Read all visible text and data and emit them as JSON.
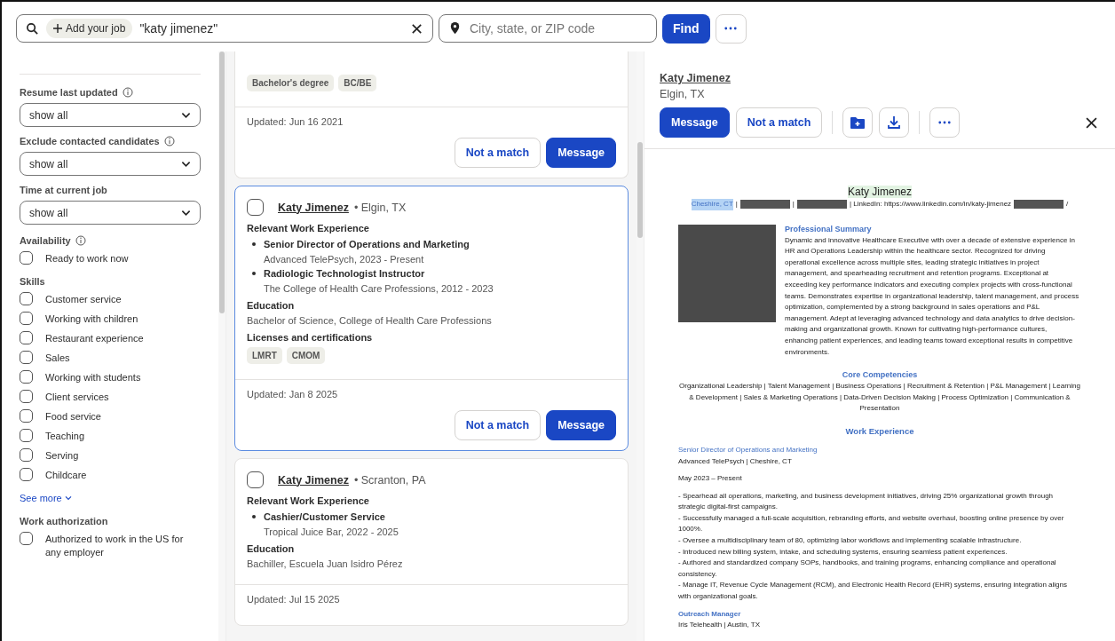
{
  "search": {
    "chip": "Add your job",
    "query": "\"katy jimenez\"",
    "location_placeholder": "City, state, or ZIP code",
    "find": "Find"
  },
  "filters": {
    "dropdowns": [
      {
        "label": "Resume last updated",
        "info": true,
        "value": "show all"
      },
      {
        "label": "Exclude contacted candidates",
        "info": true,
        "value": "show all"
      },
      {
        "label": "Time at current job",
        "info": false,
        "value": "show all"
      }
    ],
    "groups": [
      {
        "label": "Availability",
        "info": true,
        "options": [
          {
            "label": "Ready to work now",
            "checked": false
          }
        ]
      },
      {
        "label": "Skills",
        "info": false,
        "options": [
          {
            "label": "Customer service",
            "checked": false
          },
          {
            "label": "Working with children",
            "checked": false
          },
          {
            "label": "Restaurant experience",
            "checked": false
          },
          {
            "label": "Sales",
            "checked": false
          },
          {
            "label": "Working with students",
            "checked": false
          },
          {
            "label": "Client services",
            "checked": false
          },
          {
            "label": "Food service",
            "checked": false
          },
          {
            "label": "Teaching",
            "checked": false
          },
          {
            "label": "Serving",
            "checked": false
          },
          {
            "label": "Childcare",
            "checked": false
          }
        ],
        "more": "See more"
      },
      {
        "label": "Work authorization",
        "info": false,
        "options": [
          {
            "label": "Authorized to work in the US for any employer",
            "checked": false
          }
        ]
      }
    ]
  },
  "candidates": [
    {
      "selected": false,
      "sections": [
        {
          "kind": "tags",
          "items": [
            "Bachelor's degree",
            "BC/BE"
          ]
        }
      ],
      "updated": "Updated: Jun 16 2021",
      "actions": [
        "Not a match",
        "Message"
      ]
    },
    {
      "selected": true,
      "checked": false,
      "name": "Katy Jimenez",
      "location": "• Elgin, TX",
      "sections": [
        {
          "kind": "jobs",
          "heading": "Relevant Work Experience",
          "items": [
            {
              "title": "Senior Director of Operations and Marketing",
              "detail": "Advanced TelePsych, 2023 - Present"
            },
            {
              "title": "Radiologic Technologist Instructor",
              "detail": "The College of Health Care Professions, 2012 - 2023"
            }
          ]
        },
        {
          "kind": "text",
          "heading": "Education",
          "items": [
            "Bachelor of Science, College of Health Care Professions"
          ]
        },
        {
          "kind": "tags",
          "heading": "Licenses and certifications",
          "items": [
            "LMRT",
            "CMOM"
          ]
        }
      ],
      "updated": "Updated: Jan 8 2025",
      "actions": [
        "Not a match",
        "Message"
      ]
    },
    {
      "selected": false,
      "checked": false,
      "name": "Katy Jimenez",
      "location": "• Scranton, PA",
      "sections": [
        {
          "kind": "jobs",
          "heading": "Relevant Work Experience",
          "items": [
            {
              "title": "Cashier/Customer Service",
              "detail": "Tropical Juice Bar, 2022 - 2025"
            }
          ]
        },
        {
          "kind": "text",
          "heading": "Education",
          "items": [
            "Bachiller, Escuela Juan Isidro Pérez"
          ]
        }
      ],
      "updated": "Updated: Jul 15 2025"
    }
  ],
  "detail": {
    "name": "Katy Jimenez",
    "location": "Elgin, TX",
    "actions": [
      "Message",
      "Not a match"
    ],
    "resume": {
      "name": "Katy Jimenez",
      "contact": [
        {
          "kind": "highlight",
          "text": "Cheshire, CT"
        },
        {
          "kind": "text",
          "text": "|"
        },
        {
          "kind": "redacted"
        },
        {
          "kind": "text",
          "text": "|"
        },
        {
          "kind": "redacted"
        },
        {
          "kind": "text",
          "text": "| LinkedIn: https://www.linkedin.com/in/katy-jimenez"
        },
        {
          "kind": "redacted"
        },
        {
          "kind": "text",
          "text": "/"
        }
      ],
      "summary_heading": "Professional Summary",
      "summary": "Dynamic and innovative Healthcare Executive with over a decade of extensive experience in HR and Operations Leadership within the healthcare sector. Recognized for driving operational excellence across multiple sites, leading strategic initiatives in project management, and spearheading recruitment and retention programs. Exceptional at exceeding key performance indicators and executing complex projects with cross-functional teams. Demonstrates expertise in organizational leadership, talent management, and process optimization, complemented by a strong background in sales operations and P&L management. Adept at leveraging advanced technology and data analytics to drive decision-making and organizational growth. Known for cultivating high-performance cultures, enhancing patient experiences, and leading teams toward exceptional results in competitive environments.",
      "competencies_heading": "Core Competencies",
      "competencies": "Organizational Leadership | Talent Management | Business Operations | Recruitment & Retention | P&L Management | Learning & Development | Sales & Marketing Operations | Data-Driven Decision Making | Process Optimization | Communication & Presentation",
      "work_heading": "Work Experience",
      "jobs": [
        {
          "title": "Senior Director of Operations and Marketing",
          "company": "Advanced TelePsych | Cheshire, CT",
          "dates": "May 2023 – Present",
          "bullets": [
            "- Spearhead all operations, marketing, and business development initiatives, driving 25% organizational growth through strategic digital-first campaigns.",
            "- Successfully managed a full-scale acquisition, rebranding efforts, and website overhaul, boosting online presence by over 1000%.",
            "- Oversee a multidisciplinary team of 80, optimizing labor workflows and implementing scalable infrastructure.",
            "- Introduced new billing system, intake, and scheduling systems, ensuring seamless patient experiences.",
            "- Authored and standardized company SOPs, handbooks, and training programs, enhancing compliance and operational consistency.",
            "- Manage IT, Revenue Cycle Management (RCM), and Electronic Health Record (EHR) systems, ensuring integration aligns with organizational goals."
          ]
        },
        {
          "title": "Outreach Manager",
          "company": "Iris Telehealth | Austin, TX"
        }
      ]
    }
  }
}
